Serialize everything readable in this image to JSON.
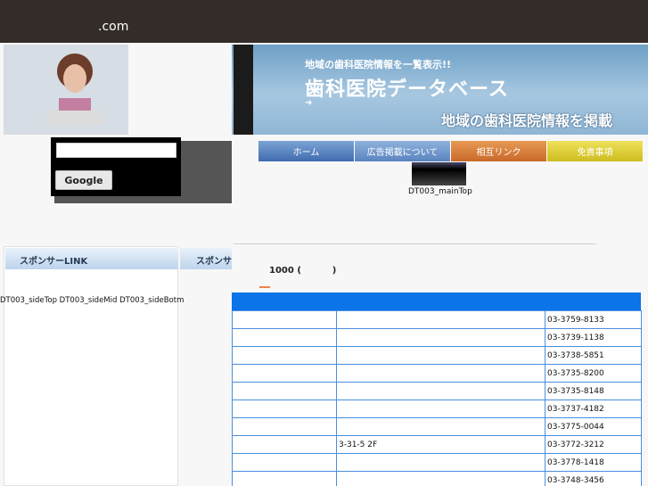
{
  "site": {
    "domain": ".com"
  },
  "header": {
    "banner_subtitle": "地域の歯科医院情報を一覧表示!!",
    "banner_title": "歯科医院データベース",
    "banner_tagline": "地域の歯科医院情報を掲載"
  },
  "search": {
    "value": "",
    "button_label": "Google"
  },
  "nav": {
    "items": [
      {
        "label": "ホーム",
        "color": "#3f6cb0"
      },
      {
        "label": "広告掲載について",
        "color": "#5a84c0"
      },
      {
        "label": "相互リンク",
        "color": "#c9692a"
      },
      {
        "label": "免責事項",
        "color": "#cdbd1f"
      }
    ]
  },
  "ads": {
    "main_top": "DT003_mainTop",
    "side_labels": "DT003_sideTop DT003_sideMid DT003_sideBotm"
  },
  "sidebar": {
    "header": "スポンサーLINK",
    "header2": "スポンサーLINK"
  },
  "main": {
    "count_title": "1000 (          )"
  },
  "table": {
    "header_color": "#0a74e8",
    "rows": [
      {
        "name": "",
        "address": "",
        "phone": "03-3759-8133"
      },
      {
        "name": "",
        "address": "",
        "phone": "03-3739-1138"
      },
      {
        "name": "",
        "address": "",
        "phone": "03-3738-5851"
      },
      {
        "name": "",
        "address": "",
        "phone": "03-3735-8200"
      },
      {
        "name": "",
        "address": "",
        "phone": "03-3735-8148"
      },
      {
        "name": "",
        "address": "",
        "phone": "03-3737-4182"
      },
      {
        "name": "",
        "address": "",
        "phone": "03-3775-0044"
      },
      {
        "name": "",
        "address": "3-31-5    2F",
        "phone": "03-3772-3212"
      },
      {
        "name": "",
        "address": "",
        "phone": "03-3778-1418"
      },
      {
        "name": "",
        "address": "",
        "phone": "03-3748-3456"
      }
    ]
  }
}
